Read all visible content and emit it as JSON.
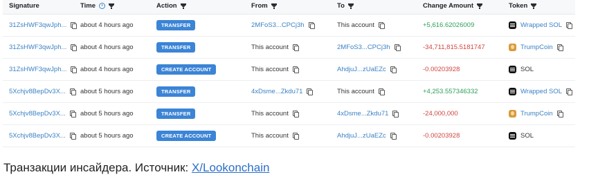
{
  "headers": {
    "signature": "Signature",
    "time": "Time",
    "action": "Action",
    "from": "From",
    "to": "To",
    "change_amount": "Change Amount",
    "token": "Token"
  },
  "rows": [
    {
      "signature": "31ZsHWF3qwJph...",
      "time": "about 4 hours ago",
      "action": "TRANSFER",
      "from": "2MFoS3...CPCj3h",
      "from_link": true,
      "to": "This account",
      "to_link": false,
      "amount": "+5,616.62026009",
      "amount_sign": "pos",
      "token": "Wrapped SOL",
      "token_icon": "wrapped-sol-icon",
      "token_link": true
    },
    {
      "signature": "31ZsHWF3qwJph...",
      "time": "about 4 hours ago",
      "action": "TRANSFER",
      "from": "This account",
      "from_link": false,
      "to": "2MFoS3...CPCj3h",
      "to_link": true,
      "amount": "-34,711,815.5181747",
      "amount_sign": "neg",
      "token": "TrumpCoin",
      "token_icon": "trumpcoin-icon",
      "token_link": true
    },
    {
      "signature": "31ZsHWF3qwJph...",
      "time": "about 4 hours ago",
      "action": "CREATE ACCOUNT",
      "from": "This account",
      "from_link": false,
      "to": "AhdjuJ...zUaEZc",
      "to_link": true,
      "amount": "-0.00203928",
      "amount_sign": "neg",
      "token": "SOL",
      "token_icon": "sol-icon",
      "token_link": false
    },
    {
      "signature": "5Xchjv8BepDv3X...",
      "time": "about 5 hours ago",
      "action": "TRANSFER",
      "from": "4xDsme...Zkdu71",
      "from_link": true,
      "to": "This account",
      "to_link": false,
      "amount": "+4,253.557346332",
      "amount_sign": "pos",
      "token": "Wrapped SOL",
      "token_icon": "wrapped-sol-icon",
      "token_link": true
    },
    {
      "signature": "5Xchjv8BepDv3X...",
      "time": "about 5 hours ago",
      "action": "TRANSFER",
      "from": "This account",
      "from_link": false,
      "to": "4xDsme...Zkdu71",
      "to_link": true,
      "amount": "-24,000,000",
      "amount_sign": "neg",
      "token": "TrumpCoin",
      "token_icon": "trumpcoin-icon",
      "token_link": true
    },
    {
      "signature": "5Xchjv8BepDv3X...",
      "time": "about 5 hours ago",
      "action": "CREATE ACCOUNT",
      "from": "This account",
      "from_link": false,
      "to": "AhdjuJ...zUaEZc",
      "to_link": true,
      "amount": "-0.00203928",
      "amount_sign": "neg",
      "token": "SOL",
      "token_icon": "sol-icon",
      "token_link": false
    }
  ],
  "caption": {
    "text": "Транзакции инсайдера. Источник: ",
    "link": "X/Lookonchain"
  },
  "colors": {
    "link": "#3b82c4",
    "positive": "#2e9e57",
    "negative": "#d0453f",
    "badge": "#3b84d6"
  }
}
